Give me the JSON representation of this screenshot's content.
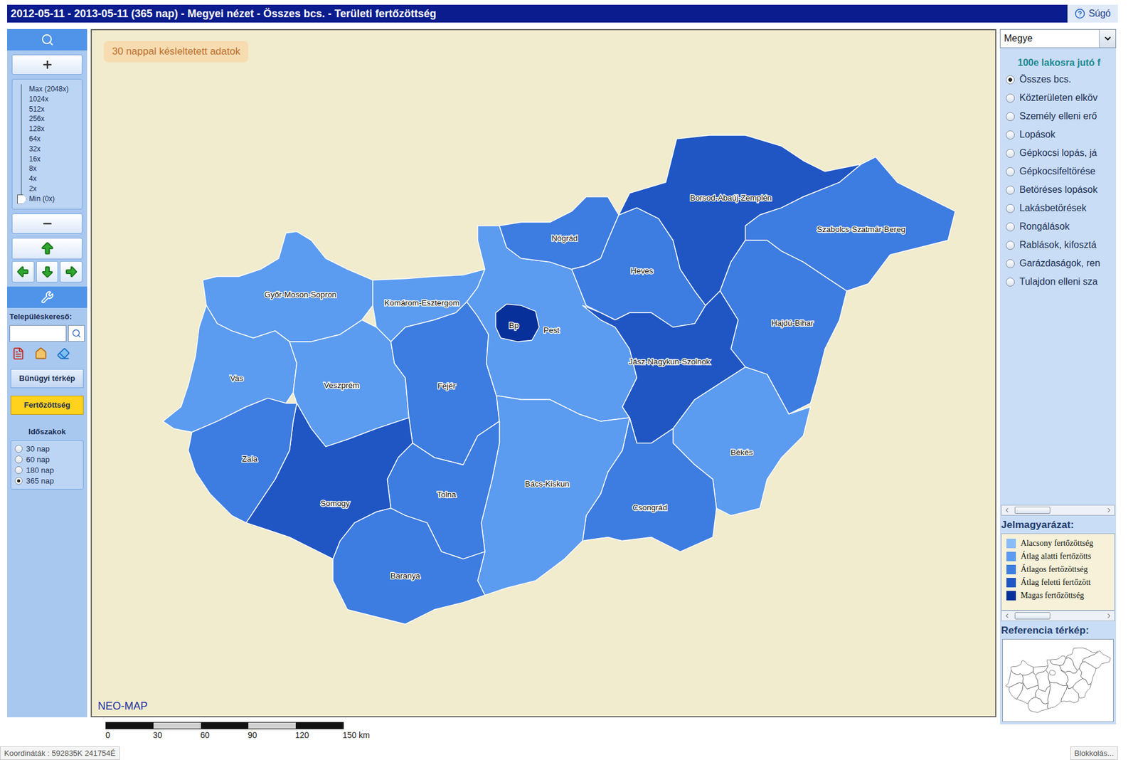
{
  "window": {
    "title": "2012-05-11 - 2013-05-11 (365 nap) - Megyei nézet - Összes bcs. - Területi fertőzöttség",
    "help": "Súgó"
  },
  "toolbar": {
    "zoom": {
      "labels": [
        "Max (2048x)",
        "1024x",
        "512x",
        "256x",
        "128x",
        "64x",
        "32x",
        "16x",
        "8x",
        "4x",
        "2x",
        "Min (0x)"
      ],
      "level": 0
    },
    "search_label": "Településkereső:",
    "search_value": "",
    "modes": [
      {
        "label": "Bűnügyi térkép",
        "selected": false
      },
      {
        "label": "Fertőzöttség",
        "selected": true
      }
    ],
    "periods_title": "Időszakok",
    "periods": [
      {
        "label": "30 nap",
        "selected": false
      },
      {
        "label": "60 nap",
        "selected": false
      },
      {
        "label": "180 nap",
        "selected": false
      },
      {
        "label": "365 nap",
        "selected": true
      }
    ]
  },
  "map": {
    "badge": "30 nappal késleltetett adatok",
    "logo": "NEO-MAP",
    "counties": [
      {
        "name": "Győr-Moson-Sopron",
        "color": "#5b9bf0"
      },
      {
        "name": "Komárom-Esztergom",
        "color": "#5b9bf0"
      },
      {
        "name": "Vas",
        "color": "#5b9bf0"
      },
      {
        "name": "Veszprém",
        "color": "#5b9bf0"
      },
      {
        "name": "Fejér",
        "color": "#3d7ce0"
      },
      {
        "name": "Pest",
        "color": "#5b9bf0"
      },
      {
        "name": "Bp",
        "color": "#08309a"
      },
      {
        "name": "Nógrád",
        "color": "#3d7ce0"
      },
      {
        "name": "Heves",
        "color": "#3d7ce0"
      },
      {
        "name": "Borsod-Abaúj-Zemplén",
        "color": "#1f56c4"
      },
      {
        "name": "Szabolcs-Szatmár-Bereg",
        "color": "#3d7ce0"
      },
      {
        "name": "Hajdú-Bihar",
        "color": "#3d7ce0"
      },
      {
        "name": "Jász-Nagykun-Szolnok",
        "color": "#1f56c4"
      },
      {
        "name": "Békés",
        "color": "#5b9bf0"
      },
      {
        "name": "Csongrád",
        "color": "#3d7ce0"
      },
      {
        "name": "Bács-Kiskun",
        "color": "#5b9bf0"
      },
      {
        "name": "Tolna",
        "color": "#3d7ce0"
      },
      {
        "name": "Somogy",
        "color": "#1f56c4"
      },
      {
        "name": "Zala",
        "color": "#3d7ce0"
      },
      {
        "name": "Baranya",
        "color": "#3d7ce0"
      }
    ]
  },
  "scale": {
    "ticks": [
      "0",
      "30",
      "60",
      "90",
      "120",
      "150 km"
    ]
  },
  "side_panel": {
    "unit_select": "Megye",
    "caption": "100e lakosra jutó f",
    "categories": [
      {
        "label": "Összes bcs.",
        "selected": true
      },
      {
        "label": "Közterületen elköv",
        "selected": false
      },
      {
        "label": "Személy elleni erő",
        "selected": false
      },
      {
        "label": "Lopások",
        "selected": false
      },
      {
        "label": "Gépkocsi lopás, já",
        "selected": false
      },
      {
        "label": "Gépkocsifeltörése",
        "selected": false
      },
      {
        "label": "Betöréses lopások",
        "selected": false
      },
      {
        "label": "Lakásbetörések",
        "selected": false
      },
      {
        "label": "Rongálások",
        "selected": false
      },
      {
        "label": "Rablások, kifosztá",
        "selected": false
      },
      {
        "label": "Garázdaságok, ren",
        "selected": false
      },
      {
        "label": "Tulajdon elleni sza",
        "selected": false
      }
    ],
    "legend_title": "Jelmagyarázat:",
    "legend": [
      {
        "label": "Alacsony fertőzöttség",
        "color": "#8cbcf7"
      },
      {
        "label": "Átlag alatti fertőzötts",
        "color": "#5b9bf0"
      },
      {
        "label": "Átlagos fertőzöttség",
        "color": "#3d7ce0"
      },
      {
        "label": "Átlag feletti fertőzött",
        "color": "#1f56c4"
      },
      {
        "label": "Magas fertőzöttség",
        "color": "#08309a"
      }
    ],
    "reference_title": "Referencia térkép:"
  },
  "status_bar": {
    "coordinates": "Koordináták : 592835K 241754É",
    "right": "Blokkolás..."
  }
}
